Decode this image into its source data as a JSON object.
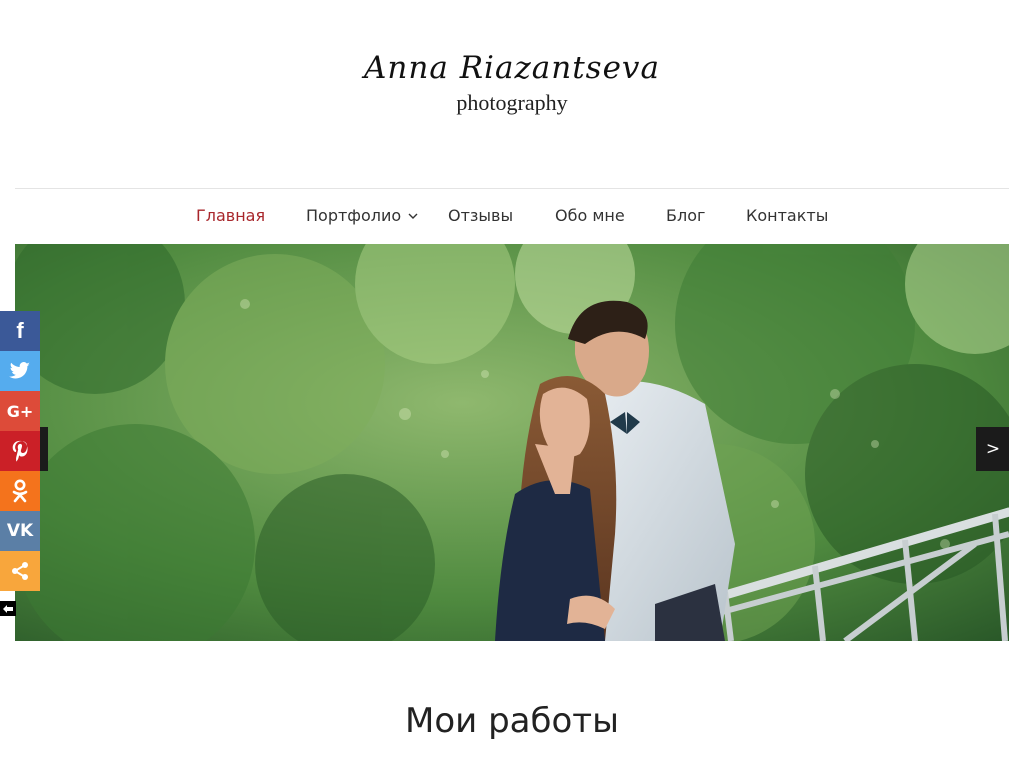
{
  "logo": {
    "name": "Anna Riazantseva",
    "subtitle": "photography"
  },
  "nav": {
    "items": [
      {
        "label": "Главная",
        "active": true
      },
      {
        "label": "Портфолио",
        "has_dropdown": true
      },
      {
        "label": "Отзывы"
      },
      {
        "label": "Обо мне"
      },
      {
        "label": "Блог"
      },
      {
        "label": "Контакты"
      }
    ]
  },
  "slider": {
    "prev_label": "<",
    "next_label": ">"
  },
  "share": {
    "buttons": [
      {
        "name": "facebook",
        "icon": "facebook-icon",
        "glyph": "f",
        "color": "#3b5998"
      },
      {
        "name": "twitter",
        "icon": "twitter-icon",
        "color": "#55acee"
      },
      {
        "name": "google-plus",
        "icon": "google-plus-icon",
        "glyph": "G+",
        "color": "#dd4b39"
      },
      {
        "name": "pinterest",
        "icon": "pinterest-icon",
        "color": "#cb2027"
      },
      {
        "name": "odnoklassniki",
        "icon": "odnoklassniki-icon",
        "color": "#f4731c"
      },
      {
        "name": "vkontakte",
        "icon": "vk-icon",
        "glyph": "VK",
        "color": "#5b7fa6"
      },
      {
        "name": "more",
        "icon": "share-icon",
        "color": "#f8a63c"
      }
    ]
  },
  "section": {
    "title": "Мои работы"
  },
  "colors": {
    "accent": "#a8262b",
    "divider": "#e4e4e4"
  }
}
